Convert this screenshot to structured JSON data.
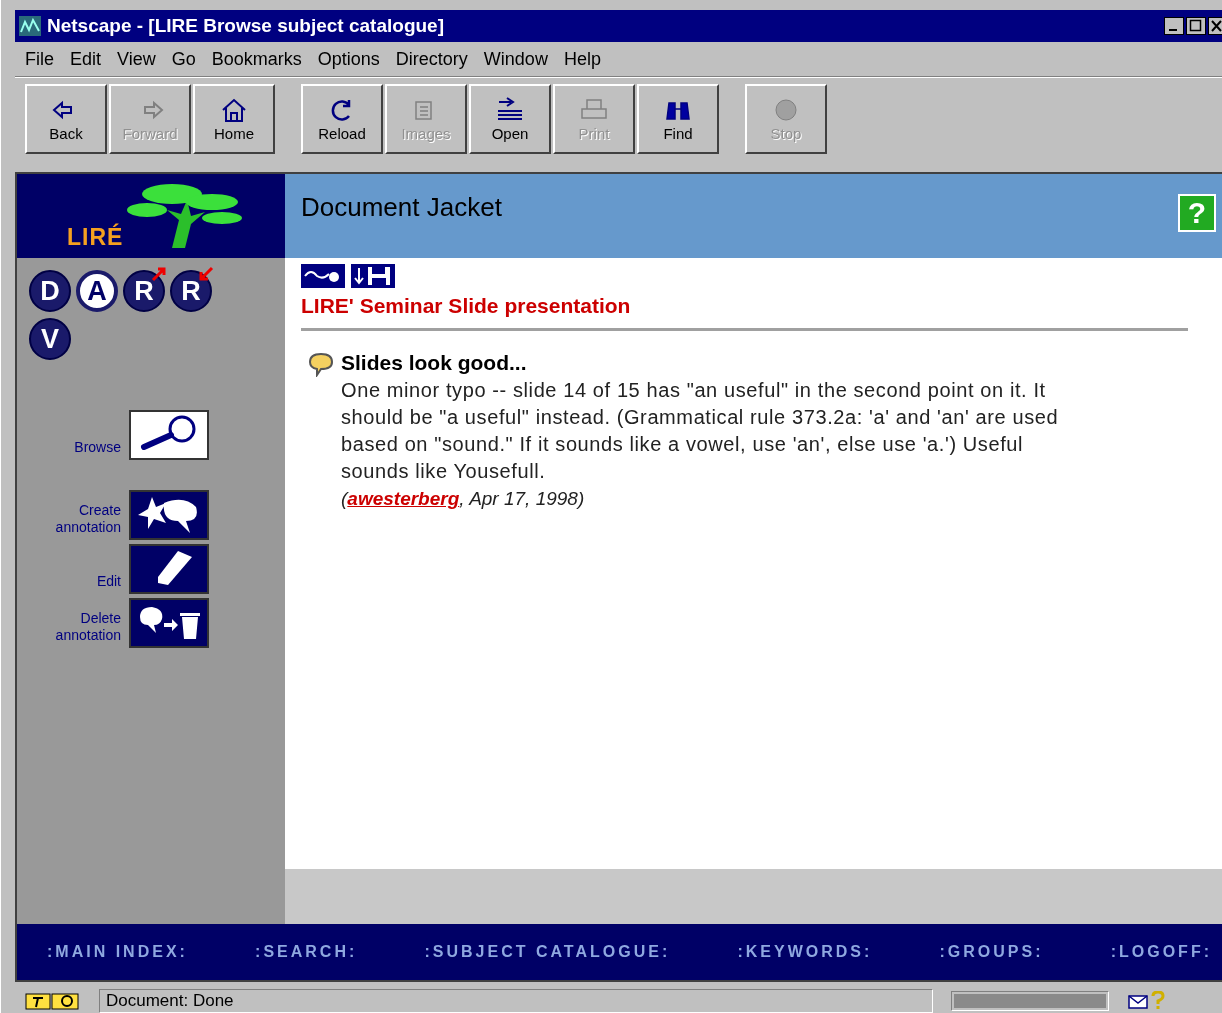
{
  "window": {
    "title": "Netscape - [LIRE Browse subject catalogue]"
  },
  "menu": [
    "File",
    "Edit",
    "View",
    "Go",
    "Bookmarks",
    "Options",
    "Directory",
    "Window",
    "Help"
  ],
  "toolbar": [
    [
      {
        "label": "Back",
        "kind": "back",
        "disabled": false
      },
      {
        "label": "Forward",
        "kind": "forward",
        "disabled": true
      },
      {
        "label": "Home",
        "kind": "home",
        "disabled": false
      }
    ],
    [
      {
        "label": "Reload",
        "kind": "reload",
        "disabled": false
      },
      {
        "label": "Images",
        "kind": "images",
        "disabled": true
      },
      {
        "label": "Open",
        "kind": "open",
        "disabled": false
      },
      {
        "label": "Print",
        "kind": "print",
        "disabled": true
      },
      {
        "label": "Find",
        "kind": "find",
        "disabled": false
      }
    ],
    [
      {
        "label": "Stop",
        "kind": "stop",
        "disabled": true
      }
    ]
  ],
  "sidebar": {
    "logo": "LIRÉ",
    "modes": [
      {
        "label": "D",
        "kind": "plain",
        "selected": false
      },
      {
        "label": "A",
        "kind": "plain",
        "selected": true
      },
      {
        "label": "R",
        "kind": "out",
        "selected": false
      },
      {
        "label": "R",
        "kind": "in",
        "selected": false
      },
      {
        "label": "V",
        "kind": "plain",
        "selected": false
      }
    ],
    "actions": [
      {
        "label": "Browse",
        "kind": "browse",
        "selected": true
      },
      {
        "label": "Create annotation",
        "kind": "create",
        "selected": false
      },
      {
        "label": "Edit",
        "kind": "edit",
        "selected": false
      },
      {
        "label": "Delete annotation",
        "kind": "delete",
        "selected": false
      }
    ]
  },
  "main": {
    "heading": "Document Jacket",
    "help": "?",
    "document_title": "LIRE' Seminar Slide presentation",
    "annotation": {
      "title": "Slides look good...",
      "body": "One minor typo -- slide 14 of 15 has \"an useful\" in the second point on it. It should be \"a useful\" instead. (Grammatical rule 373.2a: 'a' and 'an' are used based on \"sound.\" If it sounds like a vowel, use 'an', else use 'a.') Useful sounds like Yousefull.",
      "byline_prefix": "(",
      "author": "awesterberg",
      "byline_suffix": ", Apr 17, 1998)"
    }
  },
  "footer_nav": [
    ":MAIN INDEX:",
    ":SEARCH:",
    ":SUBJECT CATALOGUE:",
    ":KEYWORDS:",
    ":GROUPS:",
    ":LOGOFF:"
  ],
  "status_bar": {
    "text": "Document: Done"
  }
}
